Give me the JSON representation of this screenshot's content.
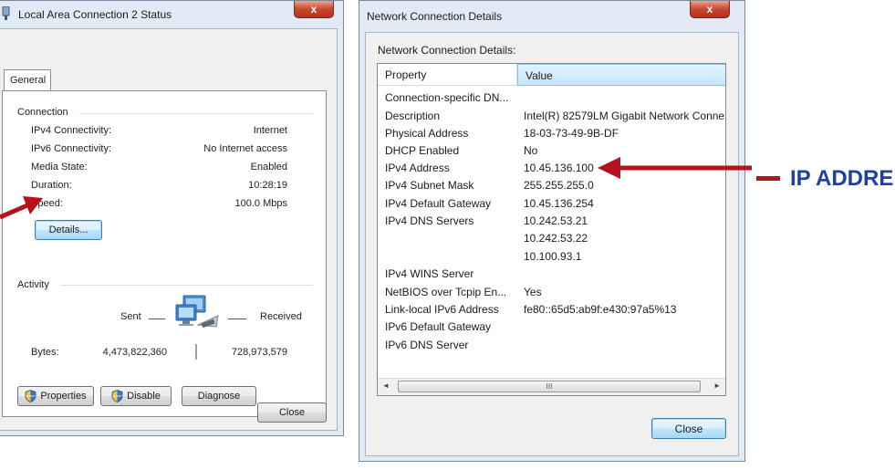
{
  "left_window": {
    "title": "Local Area Connection 2 Status",
    "close_glyph": "x",
    "tab_general": "General",
    "connection": {
      "heading": "Connection",
      "rows": [
        {
          "label": "IPv4 Connectivity:",
          "value": "Internet"
        },
        {
          "label": "IPv6 Connectivity:",
          "value": "No Internet access"
        },
        {
          "label": "Media State:",
          "value": "Enabled"
        },
        {
          "label": "Duration:",
          "value": "10:28:19"
        },
        {
          "label": "Speed:",
          "value": "100.0 Mbps"
        }
      ],
      "details_button": "Details..."
    },
    "activity": {
      "heading": "Activity",
      "sent_label": "Sent",
      "received_label": "Received",
      "bytes_label": "Bytes:",
      "bytes_sent": "4,473,822,360",
      "bytes_received": "728,973,579"
    },
    "buttons": {
      "properties": "Properties",
      "disable": "Disable",
      "diagnose": "Diagnose",
      "close": "Close"
    }
  },
  "right_window": {
    "title": "Network Connection Details",
    "close_glyph": "x",
    "caption": "Network Connection Details:",
    "columns": {
      "property": "Property",
      "value": "Value"
    },
    "rows": [
      {
        "property": "Connection-specific DN...",
        "value": ""
      },
      {
        "property": "Description",
        "value": "Intel(R) 82579LM Gigabit Network Conne"
      },
      {
        "property": "Physical Address",
        "value": "18-03-73-49-9B-DF"
      },
      {
        "property": "DHCP Enabled",
        "value": "No"
      },
      {
        "property": "IPv4 Address",
        "value": "10.45.136.100"
      },
      {
        "property": "IPv4 Subnet Mask",
        "value": "255.255.255.0"
      },
      {
        "property": "IPv4 Default Gateway",
        "value": "10.45.136.254"
      },
      {
        "property": "IPv4 DNS Servers",
        "value": "10.242.53.21"
      },
      {
        "property": "",
        "value": "10.242.53.22"
      },
      {
        "property": "",
        "value": "10.100.93.1"
      },
      {
        "property": "IPv4 WINS Server",
        "value": ""
      },
      {
        "property": "NetBIOS over Tcpip En...",
        "value": "Yes"
      },
      {
        "property": "Link-local IPv6 Address",
        "value": "fe80::65d5:ab9f:e430:97a5%13"
      },
      {
        "property": "IPv6 Default Gateway",
        "value": ""
      },
      {
        "property": "IPv6 DNS Server",
        "value": ""
      }
    ],
    "scroll_left": "◄",
    "scroll_right": "►",
    "scroll_grip": "III",
    "close_button": "Close"
  },
  "annotation": {
    "text": "IP ADDRE",
    "color": "#1f3fa8",
    "arrow_color": "#b5121b"
  }
}
